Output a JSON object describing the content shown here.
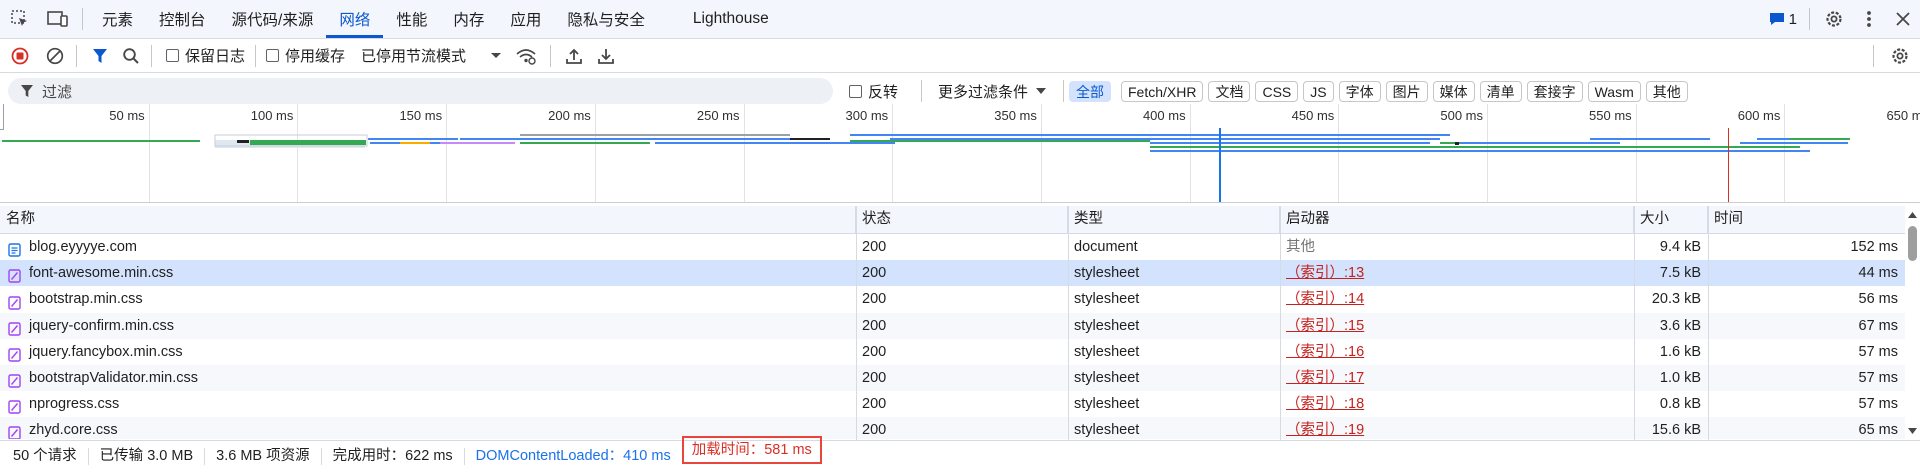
{
  "tabs": {
    "items": [
      "元素",
      "控制台",
      "源代码/来源",
      "网络",
      "性能",
      "内存",
      "应用",
      "隐私与安全",
      "Lighthouse"
    ],
    "active": "网络"
  },
  "tabbar_right": {
    "issues_count": "1"
  },
  "toolbar": {
    "preserve_log": "保留日志",
    "disable_cache": "停用缓存",
    "throttle": "已停用节流模式"
  },
  "filter": {
    "placeholder": "过滤",
    "invert": "反转",
    "more_filters": "更多过滤条件",
    "types": [
      "全部",
      "Fetch/XHR",
      "文档",
      "CSS",
      "JS",
      "字体",
      "图片",
      "媒体",
      "清单",
      "套接字",
      "Wasm",
      "其他"
    ]
  },
  "overview": {
    "ticks": [
      "50 ms",
      "100 ms",
      "150 ms",
      "200 ms",
      "250 ms",
      "300 ms",
      "350 ms",
      "400 ms",
      "450 ms",
      "500 ms",
      "550 ms",
      "600 ms",
      "650 ms"
    ],
    "dom_content_loaded_ms": 410,
    "load_ms": 581,
    "colors": {
      "dcl": "#1a73e8",
      "load": "#d93025",
      "script": "#34a853",
      "css": "#4285f4",
      "font": "#c58af9"
    }
  },
  "table": {
    "headers": {
      "name": "名称",
      "status": "状态",
      "type": "类型",
      "initiator": "启动器",
      "size": "大小",
      "time": "时间"
    },
    "rows": [
      {
        "name": "blog.eyyyye.com",
        "status": "200",
        "type": "document",
        "initiator": "其他",
        "size": "9.4 kB",
        "time": "152 ms",
        "icon": "document-icon"
      },
      {
        "name": "font-awesome.min.css",
        "status": "200",
        "type": "stylesheet",
        "initiator": "（索引）:13",
        "size": "7.5 kB",
        "time": "44 ms",
        "icon": "stylesheet-icon"
      },
      {
        "name": "bootstrap.min.css",
        "status": "200",
        "type": "stylesheet",
        "initiator": "（索引）:14",
        "size": "20.3 kB",
        "time": "56 ms",
        "icon": "stylesheet-icon"
      },
      {
        "name": "jquery-confirm.min.css",
        "status": "200",
        "type": "stylesheet",
        "initiator": "（索引）:15",
        "size": "3.6 kB",
        "time": "67 ms",
        "icon": "stylesheet-icon"
      },
      {
        "name": "jquery.fancybox.min.css",
        "status": "200",
        "type": "stylesheet",
        "initiator": "（索引）:16",
        "size": "1.6 kB",
        "time": "57 ms",
        "icon": "stylesheet-icon"
      },
      {
        "name": "bootstrapValidator.min.css",
        "status": "200",
        "type": "stylesheet",
        "initiator": "（索引）:17",
        "size": "1.0 kB",
        "time": "57 ms",
        "icon": "stylesheet-icon"
      },
      {
        "name": "nprogress.css",
        "status": "200",
        "type": "stylesheet",
        "initiator": "（索引）:18",
        "size": "0.8 kB",
        "time": "57 ms",
        "icon": "stylesheet-icon"
      },
      {
        "name": "zhyd.core.css",
        "status": "200",
        "type": "stylesheet",
        "initiator": "（索引）:19",
        "size": "15.6 kB",
        "time": "65 ms",
        "icon": "stylesheet-icon"
      }
    ]
  },
  "status": {
    "requests": "50 个请求",
    "transferred": "已传输 3.0 MB",
    "resources": "3.6 MB 项资源",
    "finish": "完成用时：622 ms",
    "dcl": "DOMContentLoaded：410 ms",
    "load": "加载时间：581 ms"
  }
}
